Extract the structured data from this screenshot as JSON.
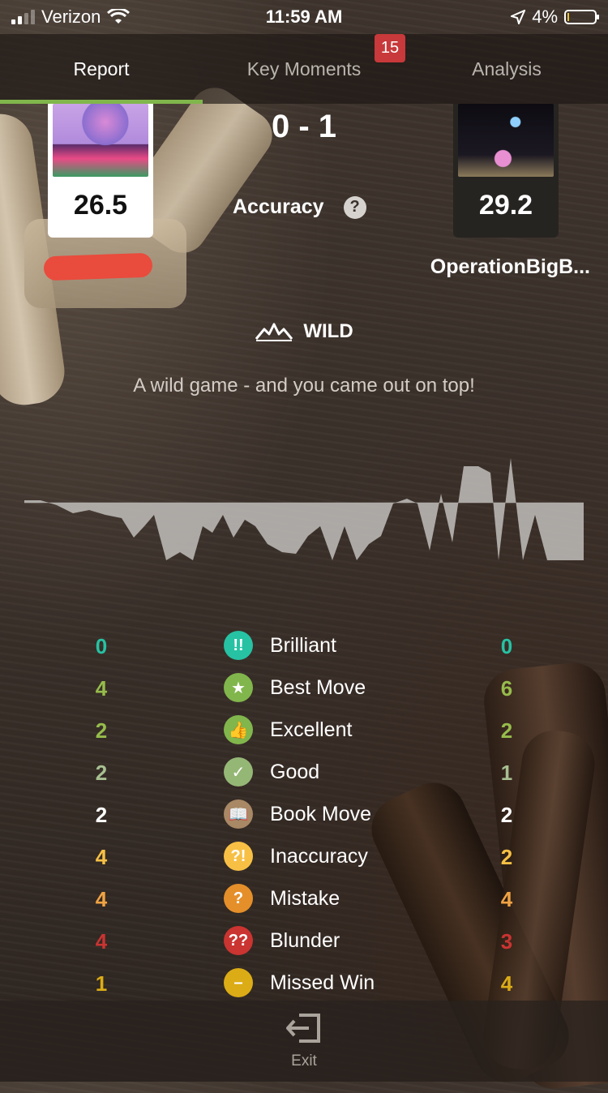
{
  "status_bar": {
    "carrier": "Verizon",
    "time": "11:59 AM",
    "battery": "4%",
    "battery_level": 0.04
  },
  "tabs": [
    {
      "label": "Report",
      "active": true
    },
    {
      "label": "Key Moments",
      "badge": "15",
      "active": false
    },
    {
      "label": "Analysis",
      "active": false
    }
  ],
  "players": {
    "white": {
      "accuracy": "26.5",
      "avatar": "player-avatar"
    },
    "black": {
      "accuracy": "29.2",
      "name": "OperationBigB...",
      "avatar": "cat-avatar"
    }
  },
  "result": "0 - 1",
  "accuracy_label": "Accuracy",
  "game_type": {
    "icon": "wild-graph-icon",
    "label": "WILD"
  },
  "subtitle": "A wild game - and you came out on top!",
  "stats": [
    {
      "label": "Brilliant",
      "icon": "brilliant-icon",
      "symbol": "!!",
      "color": "#26c2a3",
      "white": "0",
      "black": "0"
    },
    {
      "label": "Best Move",
      "icon": "star-icon",
      "symbol": "★",
      "color": "#81b64c",
      "white": "4",
      "black": "6"
    },
    {
      "label": "Excellent",
      "icon": "thumbs-up-icon",
      "symbol": "👍",
      "color": "#81b64c",
      "white": "2",
      "black": "2"
    },
    {
      "label": "Good",
      "icon": "checkmark-icon",
      "symbol": "✓",
      "color": "#95b776",
      "white": "2",
      "black": "1"
    },
    {
      "label": "Book Move",
      "icon": "book-icon",
      "symbol": "📖",
      "color": "#a88865",
      "white": "2",
      "black": "2"
    },
    {
      "label": "Inaccuracy",
      "icon": "inaccuracy-icon",
      "symbol": "?!",
      "color": "#f7c045",
      "white": "4",
      "black": "2"
    },
    {
      "label": "Mistake",
      "icon": "mistake-icon",
      "symbol": "?",
      "color": "#e58f2a",
      "white": "4",
      "black": "4"
    },
    {
      "label": "Blunder",
      "icon": "blunder-icon",
      "symbol": "??",
      "color": "#ca3431",
      "white": "4",
      "black": "3"
    },
    {
      "label": "Missed Win",
      "icon": "missed-win-icon",
      "symbol": "–",
      "color": "#dbac16",
      "white": "1",
      "black": "4"
    }
  ],
  "stat_colors": {
    "Brilliant": "#26c2a3",
    "Best Move": "#96bc4b",
    "Excellent": "#96bc4b",
    "Good": "#a7bf91",
    "Book Move": "#ffffff",
    "Inaccuracy": "#f7c045",
    "Mistake": "#f0a343",
    "Blunder": "#ca3431",
    "Missed Win": "#dbac16"
  },
  "exit_label": "Exit"
}
